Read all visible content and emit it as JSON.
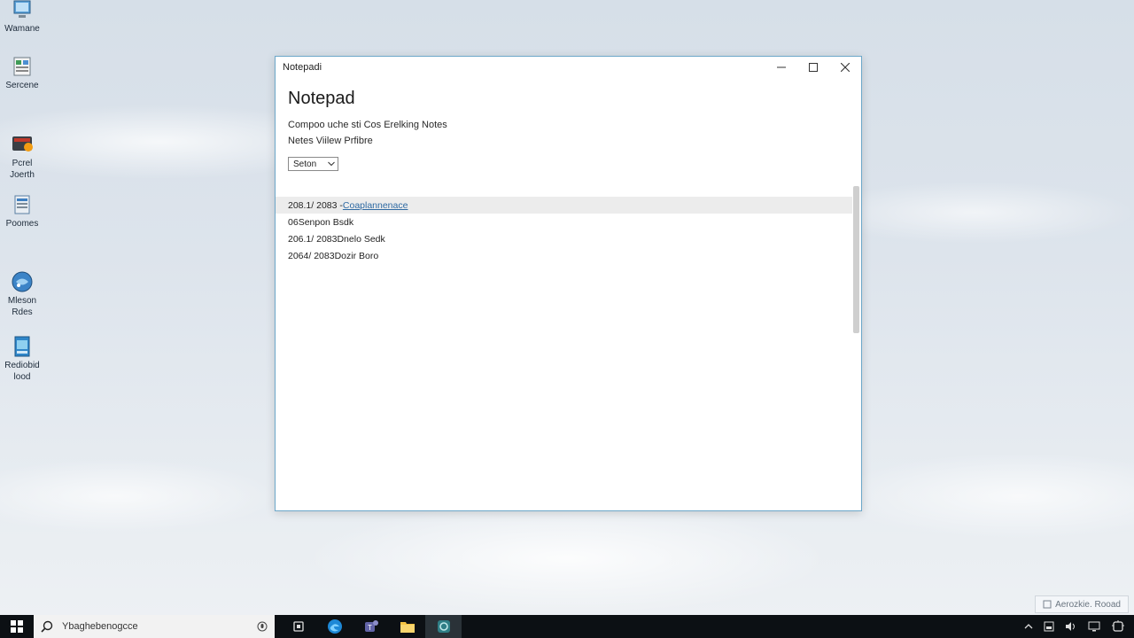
{
  "desktop": {
    "icons": [
      {
        "label": "Wamane",
        "icon": "computer-icon"
      },
      {
        "label": "Sercene",
        "icon": "spreadsheet-icon"
      },
      {
        "label": "Pcrel\nJoerth",
        "icon": "media-player-icon"
      },
      {
        "label": "Poomes",
        "icon": "document-icon"
      },
      {
        "label": "Mleson\nRdes",
        "icon": "globe-icon"
      },
      {
        "label": "Rediobid\nlood",
        "icon": "app-icon"
      }
    ]
  },
  "window": {
    "title": "Notepadi",
    "heading": "Notepad",
    "line1": "Compoo uche sti Cos Erelking Notes",
    "line2": "Netes Viilew Prfibre",
    "select_value": "Seton",
    "notes": [
      {
        "date": "208.1/ 2083 - ",
        "text": "Coaplannenace",
        "link": true
      },
      {
        "date": "06 ",
        "text": "Senpon Bsdk",
        "link": false
      },
      {
        "date": "206.1/ 2083 ",
        "text": "Dnelo Sedk",
        "link": false
      },
      {
        "date": "2064/ 2083 ",
        "text": "Dozir Boro",
        "link": false
      }
    ]
  },
  "notification": {
    "text": "Aerozkie. Rooad"
  },
  "taskbar": {
    "search_text": "Ybaghebenogcce",
    "apps": [
      "task-view-icon",
      "edge-icon",
      "teams-icon",
      "file-explorer-icon",
      "app-icon"
    ],
    "active_app_index": 4
  },
  "colors": {
    "accent": "#6ca7c9",
    "link": "#2f6aa3",
    "taskbar": "#0c1014"
  }
}
